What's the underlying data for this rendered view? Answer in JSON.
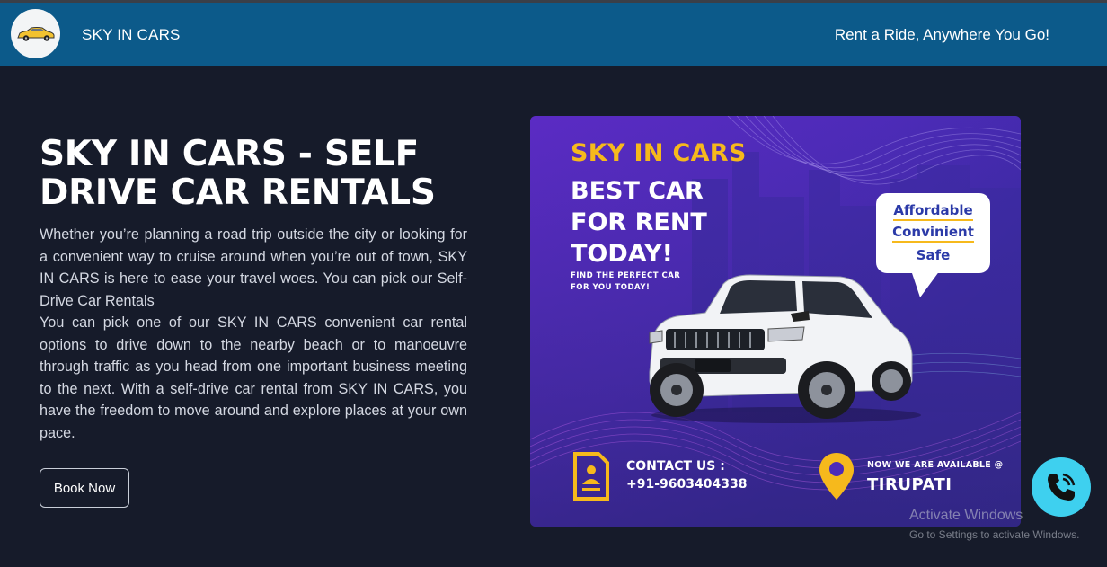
{
  "header": {
    "brand": "SKY IN CARS",
    "tagline": "Rent a Ride, Anywhere You Go!",
    "logo_icon": "car-logo-icon"
  },
  "hero": {
    "title": "SKY IN CARS - SELF DRIVE CAR RENTALS",
    "paragraph1": "Whether you’re planning a road trip outside the city or looking for a convenient way to cruise around when you’re out of town, SKY IN CARS is here to ease your travel woes. You can pick our Self-Drive Car Rentals",
    "paragraph2": "You can pick one of our SKY IN CARS convenient car rental options to drive down to the nearby beach or to manoeuvre through traffic as you head from one important business meeting to the next. With a self-drive car rental from SKY IN CARS, you have the freedom to move around and explore places at your own pace.",
    "book_button": "Book Now"
  },
  "promo": {
    "brand": "SKY IN CARS",
    "headline_line1": "BEST CAR",
    "headline_line2": "FOR RENT",
    "headline_line3": "TODAY!",
    "sub_line1": "FIND THE PERFECT CAR",
    "sub_line2": "FOR YOU TODAY!",
    "bubble": [
      "Affordable",
      "Convinient",
      "Safe"
    ],
    "contact_label": "CONTACT US :",
    "contact_phone": "+91-9603404338",
    "available_label": "NOW WE ARE AVAILABLE @",
    "available_city": "TIRUPATI",
    "colors": {
      "accent": "#f6b91c",
      "background": "#4d2bb8"
    }
  },
  "floating": {
    "call_icon": "phone-icon"
  },
  "os_watermark": {
    "line1": "Activate Windows",
    "line2": "Go to Settings to activate Windows."
  }
}
